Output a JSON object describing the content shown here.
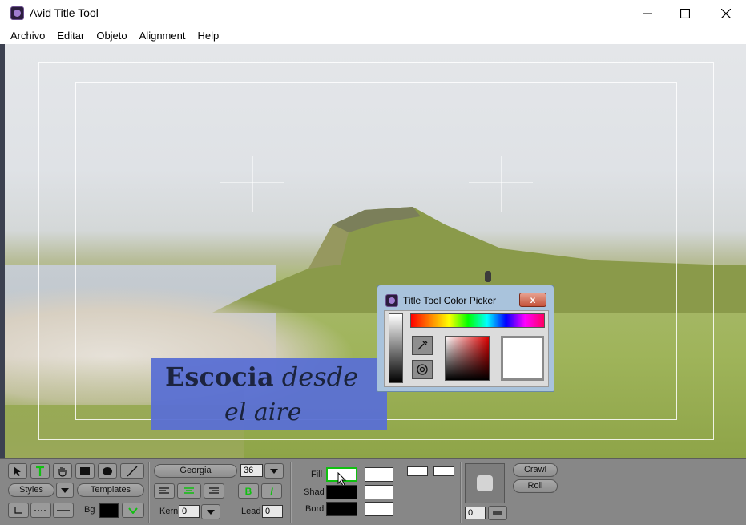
{
  "window": {
    "title": "Avid Title Tool",
    "controls": [
      "minimize",
      "maximize",
      "close"
    ]
  },
  "menu": [
    "Archivo",
    "Editar",
    "Objeto",
    "Alignment",
    "Help"
  ],
  "canvas": {
    "title_line1_bold": "Escocia",
    "title_line1_italic": "desde",
    "title_line2": "el aire",
    "text_box_color": "#5a70d4"
  },
  "color_picker": {
    "title": "Title Tool Color Picker",
    "close_label": "x",
    "selected_color": "#ffffff"
  },
  "toolbar": {
    "tools": [
      "select-arrow-icon",
      "text-tool-icon",
      "hand-icon",
      "rectangle-icon",
      "ellipse-icon",
      "line-icon"
    ],
    "font": "Georgia",
    "font_size": "36",
    "styles_label": "Styles",
    "templates_label": "Templates",
    "bg_label": "Bg",
    "kern_label": "Kern",
    "kern_value": "0",
    "lead_label": "Lead",
    "lead_value": "0",
    "fill_label": "Fill",
    "shad_label": "Shad",
    "bord_label": "Bord",
    "crawl_label": "Crawl",
    "roll_label": "Roll",
    "corner_value": "0",
    "accent_green": "#10c010"
  }
}
